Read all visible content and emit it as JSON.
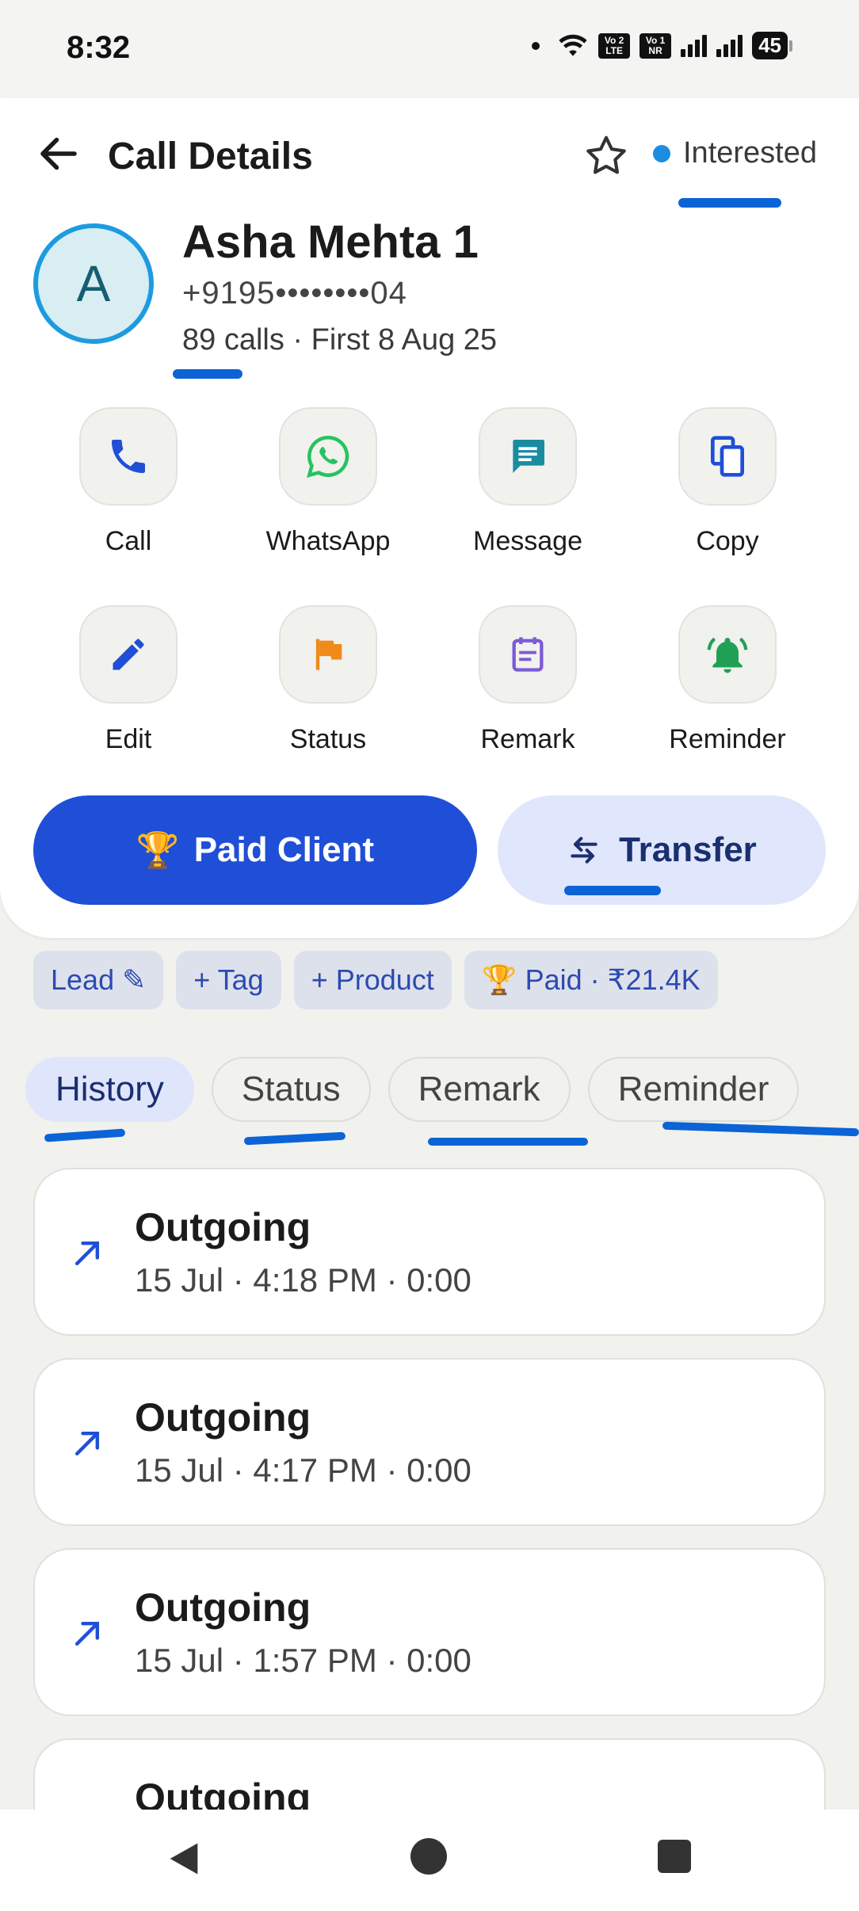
{
  "status_bar": {
    "time": "8:32",
    "battery": "45",
    "volte1": "Vo 2 LTE",
    "volte2": "Vo 1 NR"
  },
  "header": {
    "title": "Call Details",
    "lead_status": "Interested",
    "status_color": "#1e8ddf"
  },
  "contact": {
    "initial": "A",
    "name": "Asha Mehta 1",
    "phone": "+9195••••••••04",
    "meta": "89 calls · First 8 Aug 25"
  },
  "actions": [
    {
      "label": "Call",
      "icon": "phone-icon",
      "color": "#1f4fd6"
    },
    {
      "label": "WhatsApp",
      "icon": "whatsapp-icon",
      "color": "#25c35f"
    },
    {
      "label": "Message",
      "icon": "message-icon",
      "color": "#1a8ca0"
    },
    {
      "label": "Copy",
      "icon": "copy-icon",
      "color": "#1f4fd6"
    },
    {
      "label": "Edit",
      "icon": "edit-icon",
      "color": "#1f4fd6"
    },
    {
      "label": "Status",
      "icon": "flag-icon",
      "color": "#f08a1a"
    },
    {
      "label": "Remark",
      "icon": "notes-icon",
      "color": "#7b5bd6"
    },
    {
      "label": "Reminder",
      "icon": "bell-icon",
      "color": "#21a055"
    }
  ],
  "buttons": {
    "paid_client": "Paid Client",
    "paid_emoji": "🏆",
    "transfer": "Transfer"
  },
  "chips": [
    "Lead ✎",
    "+ Tag",
    "+ Product",
    "🏆 Paid · ₹21.4K"
  ],
  "tabs": [
    "History",
    "Status",
    "Remark",
    "Reminder"
  ],
  "calls": [
    {
      "type": "Outgoing",
      "detail": "15 Jul · 4:18 PM · 0:00"
    },
    {
      "type": "Outgoing",
      "detail": "15 Jul · 4:17 PM · 0:00"
    },
    {
      "type": "Outgoing",
      "detail": "15 Jul · 1:57 PM · 0:00"
    },
    {
      "type": "Outgoing",
      "detail": ""
    }
  ]
}
